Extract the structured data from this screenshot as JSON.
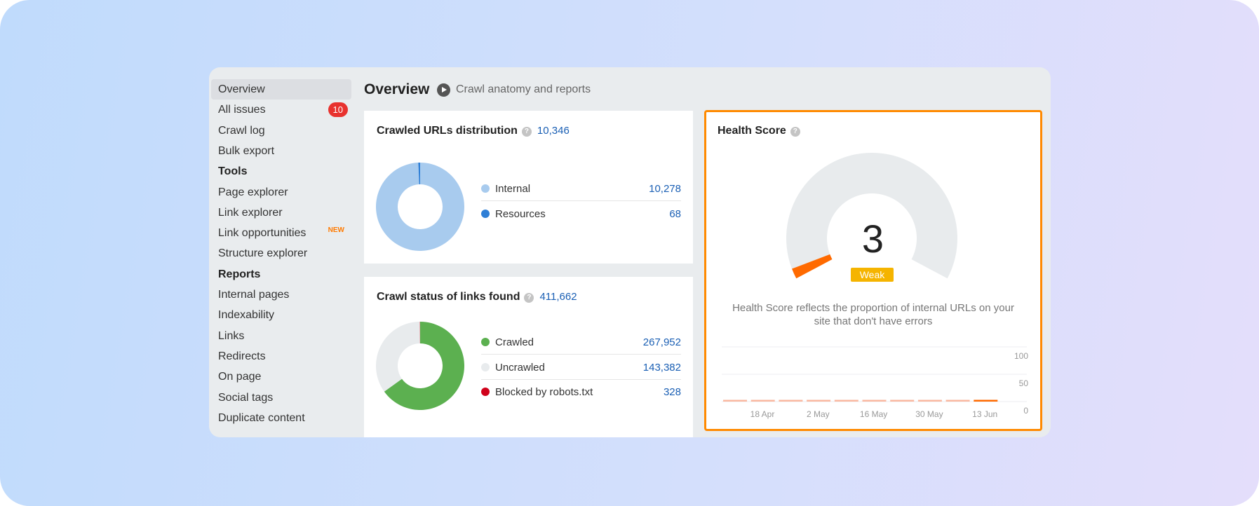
{
  "sidebar": {
    "items": [
      {
        "label": "Overview",
        "active": true
      },
      {
        "label": "All issues",
        "badge": "10"
      },
      {
        "label": "Crawl log"
      },
      {
        "label": "Bulk export"
      },
      {
        "label": "Tools",
        "heading": true
      },
      {
        "label": "Page explorer"
      },
      {
        "label": "Link explorer"
      },
      {
        "label": "Link opportunities",
        "tag": "NEW"
      },
      {
        "label": "Structure explorer"
      },
      {
        "label": "Reports",
        "heading": true
      },
      {
        "label": "Internal pages"
      },
      {
        "label": "Indexability"
      },
      {
        "label": "Links"
      },
      {
        "label": "Redirects"
      },
      {
        "label": "On page"
      },
      {
        "label": "Social tags"
      },
      {
        "label": "Duplicate content"
      }
    ]
  },
  "header": {
    "title": "Overview",
    "video_link": "Crawl anatomy and reports"
  },
  "crawled_urls": {
    "title": "Crawled URLs distribution",
    "total": "10,346",
    "items": [
      {
        "label": "Internal",
        "value": "10,278",
        "num": 10278,
        "color": "#a8cbee"
      },
      {
        "label": "Resources",
        "value": "68",
        "num": 68,
        "color": "#2f7fd6"
      }
    ]
  },
  "crawl_status": {
    "title": "Crawl status of links found",
    "total": "411,662",
    "items": [
      {
        "label": "Crawled",
        "value": "267,952",
        "num": 267952,
        "color": "#5cb050"
      },
      {
        "label": "Uncrawled",
        "value": "143,382",
        "num": 143382,
        "color": "#e8ebed"
      },
      {
        "label": "Blocked by robots.txt",
        "value": "328",
        "num": 328,
        "color": "#d0021b"
      }
    ]
  },
  "health": {
    "title": "Health Score",
    "score": "3",
    "score_value": 3,
    "score_max": 100,
    "rating": "Weak",
    "rating_color": "#f5b400",
    "gauge_color": "#ff6a00",
    "description": "Health Score reflects the proportion of internal URLs on your site that don't have errors"
  },
  "chart_data": {
    "type": "bar",
    "ylim": [
      0,
      100
    ],
    "y_ticks": [
      "100",
      "50",
      "0"
    ],
    "x_ticks": [
      "18 Apr",
      "2 May",
      "16 May",
      "30 May",
      "13 Jun"
    ],
    "values": [
      3,
      3,
      3,
      3,
      3,
      3,
      3,
      3,
      3,
      3
    ],
    "grid": true,
    "color": "#f9b8a0",
    "latest_color": "#ff6a00"
  }
}
